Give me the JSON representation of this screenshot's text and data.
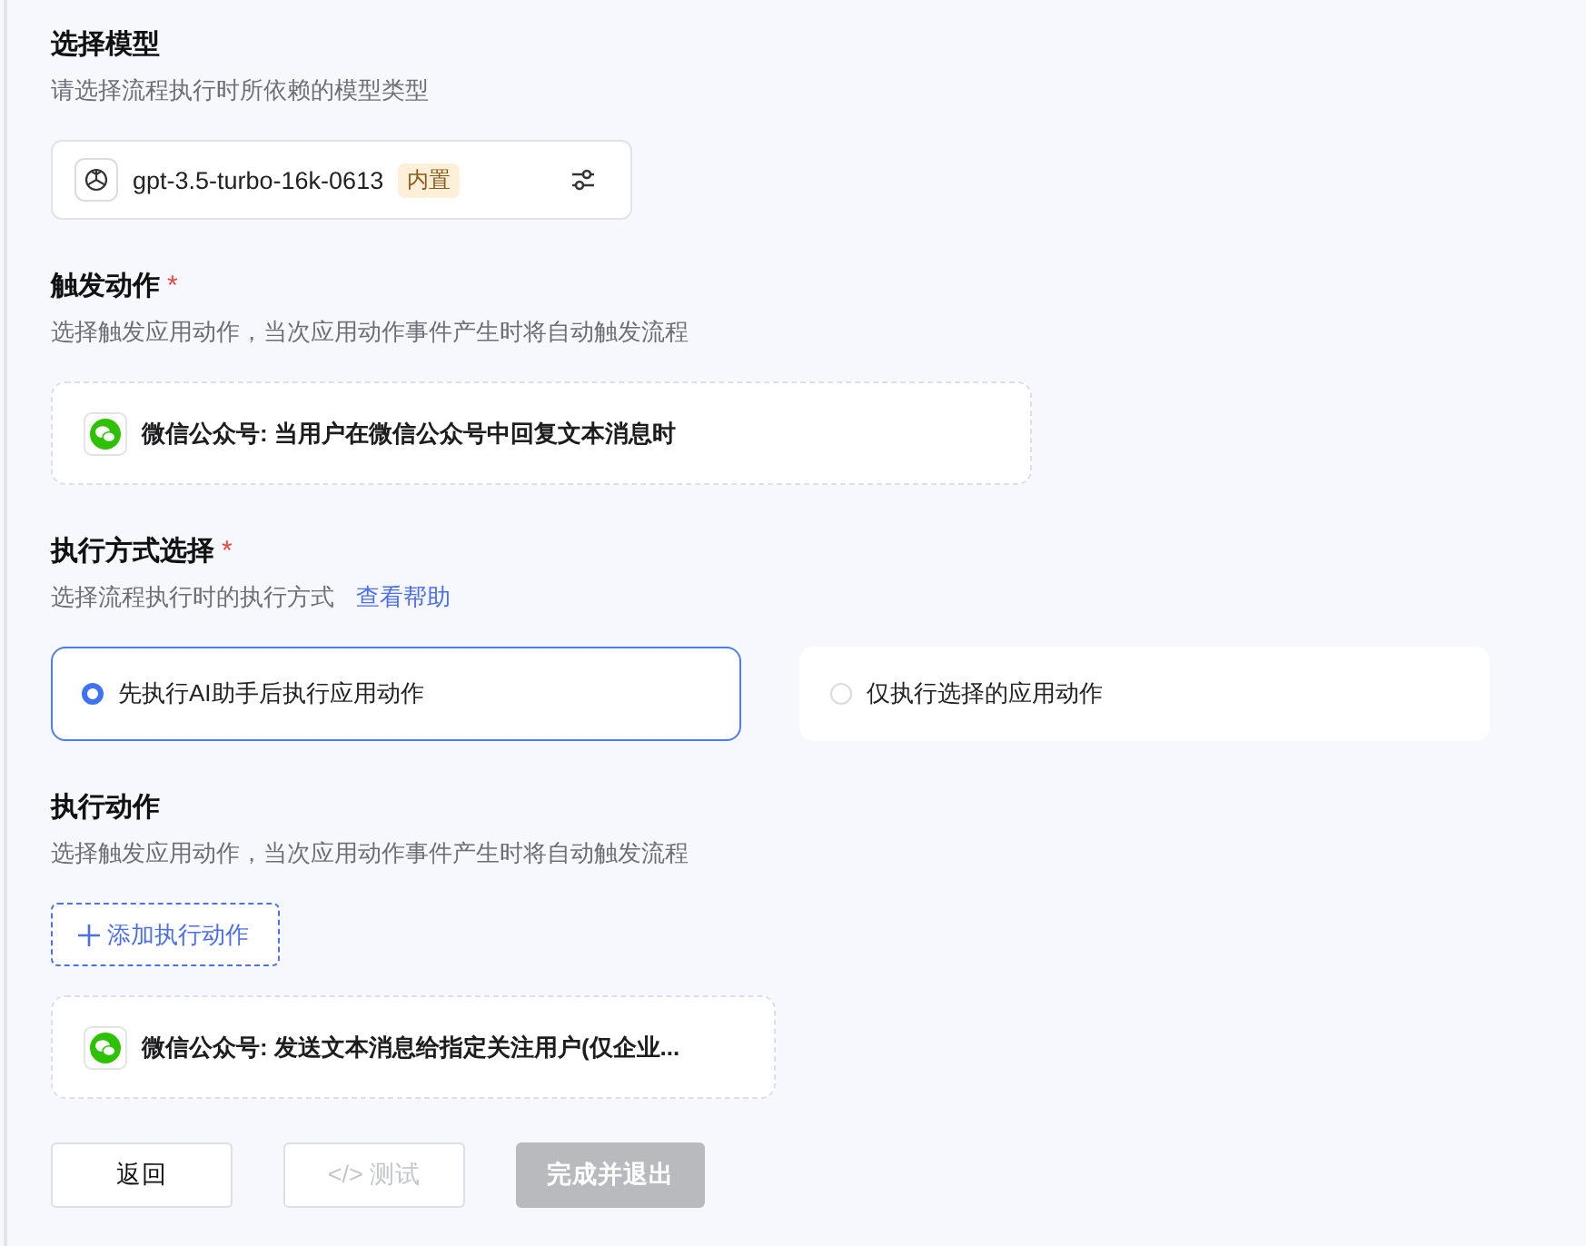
{
  "sections": [
    {
      "kind": "model",
      "title": "选择模型",
      "description": "请选择流程执行时所依赖的模型类型",
      "model": {
        "name": "gpt-3.5-turbo-16k-0613",
        "tag": "内置"
      }
    },
    {
      "kind": "trigger",
      "title": "触发动作",
      "required_mark": "*",
      "description": "选择触发应用动作，当次应用动作事件产生时将自动触发流程",
      "cards": [
        {
          "text": "微信公众号: 当用户在微信公众号中回复文本消息时"
        }
      ]
    },
    {
      "kind": "mode",
      "title": "执行方式选择",
      "required_mark": "*",
      "description": "选择流程执行时的执行方式",
      "help_link": "查看帮助",
      "options": [
        {
          "label": "先执行AI助手后执行应用动作",
          "selected": true
        },
        {
          "label": "仅执行选择的应用动作",
          "selected": false
        }
      ]
    },
    {
      "kind": "actions",
      "title": "执行动作",
      "description": "选择触发应用动作，当次应用动作事件产生时将自动触发流程",
      "add_button": "添加执行动作",
      "cards": [
        {
          "text": "微信公众号: 发送文本消息给指定关注用户(仅企业..."
        }
      ]
    }
  ],
  "footer": [
    {
      "label": "返回",
      "kind": "default",
      "disabled": false
    },
    {
      "label": "</> 测试",
      "kind": "default",
      "disabled": true
    },
    {
      "label": "完成并退出",
      "kind": "primary",
      "disabled": true
    }
  ]
}
